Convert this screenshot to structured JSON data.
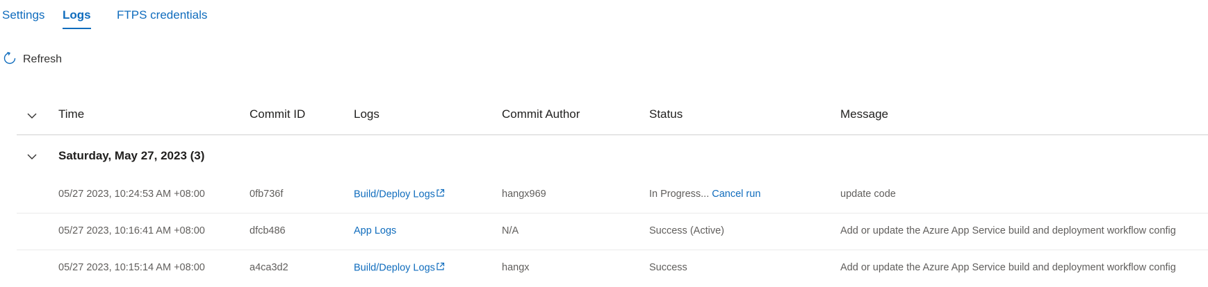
{
  "tabs": [
    {
      "label": "Settings"
    },
    {
      "label": "Logs"
    },
    {
      "label": "FTPS credentials"
    }
  ],
  "toolbar": {
    "refresh_label": "Refresh"
  },
  "columns": [
    "Time",
    "Commit ID",
    "Logs",
    "Commit Author",
    "Status",
    "Message"
  ],
  "group": {
    "title": "Saturday, May 27, 2023 (3)"
  },
  "rows": [
    {
      "time": "05/27 2023, 10:24:53 AM +08:00",
      "commit_id": "0fb736f",
      "logs": "Build/Deploy Logs",
      "author": "hangx969",
      "status": "In Progress...",
      "status_action": "Cancel run",
      "message": "update code"
    },
    {
      "time": "05/27 2023, 10:16:41 AM +08:00",
      "commit_id": "dfcb486",
      "logs": "App Logs",
      "author": "N/A",
      "status": "Success (Active)",
      "message": "Add or update the Azure App Service build and deployment workflow config"
    },
    {
      "time": "05/27 2023, 10:15:14 AM +08:00",
      "commit_id": "a4ca3d2",
      "logs": "Build/Deploy Logs",
      "author": "hangx",
      "status": "Success",
      "message": "Add or update the Azure App Service build and deployment workflow config"
    }
  ],
  "colors": {
    "accent": "#0f6cbd",
    "text": "#323130",
    "muted": "#605e5c"
  }
}
